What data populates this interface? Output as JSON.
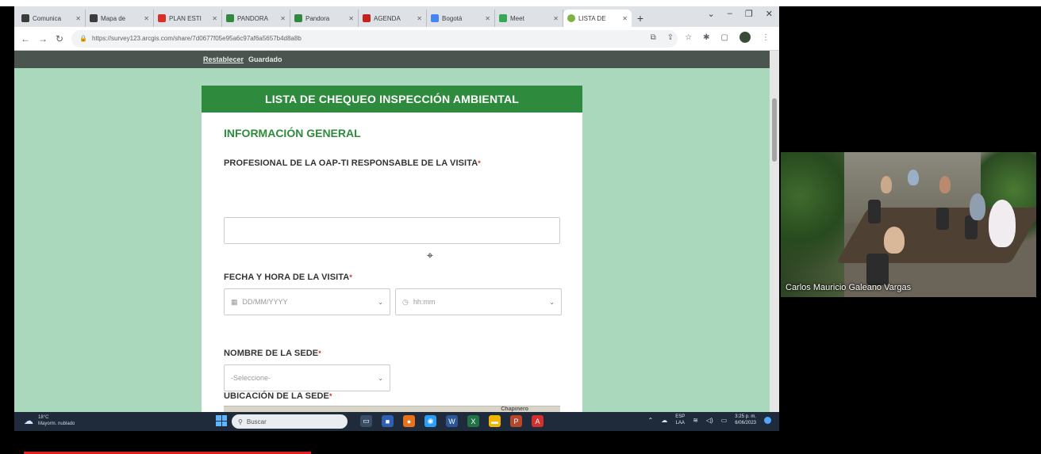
{
  "browser": {
    "tabs": [
      {
        "label": "Comunica",
        "color": "#3c3c3c",
        "active": false
      },
      {
        "label": "Mapa de",
        "color": "#3c3c3c",
        "active": false
      },
      {
        "label": "PLAN ESTI",
        "color": "#d93025",
        "active": false
      },
      {
        "label": "PANDORA",
        "color": "#2e8b3e",
        "active": false
      },
      {
        "label": "Pandora",
        "color": "#2e8b3e",
        "active": false
      },
      {
        "label": "AGENDA",
        "color": "#c5221f",
        "active": false
      },
      {
        "label": "Bogotá",
        "color": "#4285f4",
        "active": false
      },
      {
        "label": "Meet",
        "color": "#34a853",
        "active": false
      },
      {
        "label": "LISTA DE",
        "color": "#7cb342",
        "active": true
      }
    ],
    "new_tab": "+",
    "window_controls": [
      "⌄",
      "–",
      "❐",
      "✕"
    ],
    "url": "https://survey123.arcgis.com/share/7d0677f05e95a6c97af6a5657b4d8a8b"
  },
  "page": {
    "topbar": {
      "reset_link": "Restablecer",
      "save_label": "Guardado"
    },
    "form": {
      "header": "LISTA DE CHEQUEO INSPECCIÓN AMBIENTAL",
      "section_title": "INFORMACIÓN GENERAL",
      "q1": {
        "label": "PROFESIONAL DE LA OAP-TI RESPONSABLE DE LA VISITA",
        "required": "*",
        "value": ""
      },
      "q2": {
        "label": "FECHA Y HORA DE LA VISITA",
        "required": "*",
        "date_placeholder": "DD/MM/YYYY",
        "time_placeholder": "hh:mm"
      },
      "q3": {
        "label": "NOMBRE DE LA SEDE",
        "required": "*",
        "select_value": "-Seleccione-"
      },
      "q4": {
        "label": "UBICACIÓN DE LA SEDE",
        "required": "*",
        "map_text": "Chapinero"
      }
    }
  },
  "taskbar": {
    "weather": {
      "temp": "18°C",
      "condition": "Mayorm. nublado"
    },
    "search_placeholder": "Buscar",
    "tray": {
      "lang_top": "ESP",
      "lang_bottom": "LAA",
      "time": "3:25 p. m.",
      "date": "6/06/2023"
    }
  },
  "video": {
    "participant_name": "Carlos Mauricio Galeano Vargas"
  },
  "colors": {
    "form_green": "#2e8b3e",
    "page_bg": "#a9d8bd",
    "progress_red": "#e02020"
  }
}
